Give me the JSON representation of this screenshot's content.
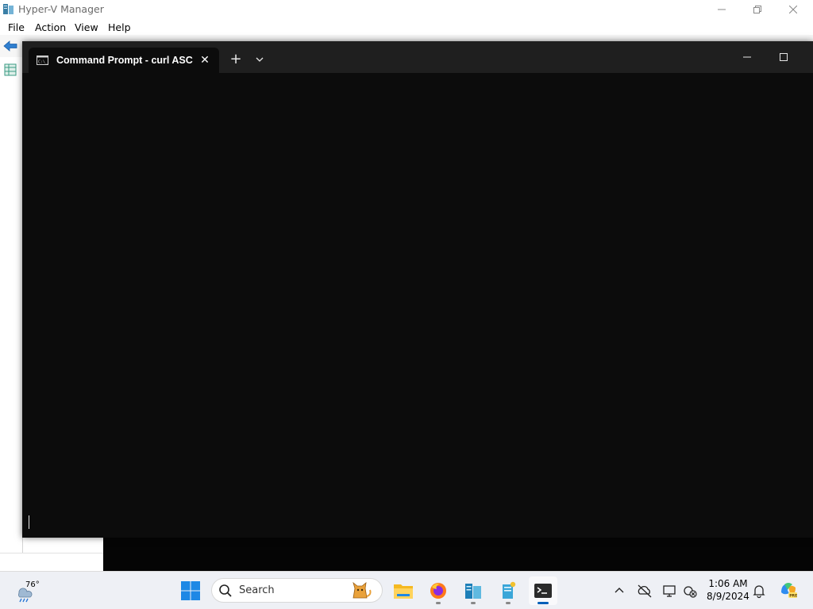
{
  "background_window": {
    "title": "Hyper-V Manager",
    "menus": [
      "File",
      "Action",
      "View",
      "Help"
    ]
  },
  "terminal": {
    "tab_title": "Command Prompt - curl  ASC",
    "tab_icon": "cmd-icon",
    "new_tab_glyph": "+",
    "close_glyph": "✕"
  },
  "taskbar": {
    "weather_temp": "76°",
    "search_placeholder": "Search",
    "apps": [
      {
        "name": "file-explorer"
      },
      {
        "name": "firefox"
      },
      {
        "name": "hyper-v-manager"
      },
      {
        "name": "hyper-v-vm-connect"
      },
      {
        "name": "terminal",
        "active": true
      }
    ],
    "clock_time": "1:06 AM",
    "clock_date": "8/9/2024"
  },
  "colors": {
    "terminal_bg": "#0c0c0c",
    "terminal_titlebar": "#1f1f1f",
    "taskbar_bg": "#eef0f5",
    "active_indicator": "#005fb8"
  }
}
